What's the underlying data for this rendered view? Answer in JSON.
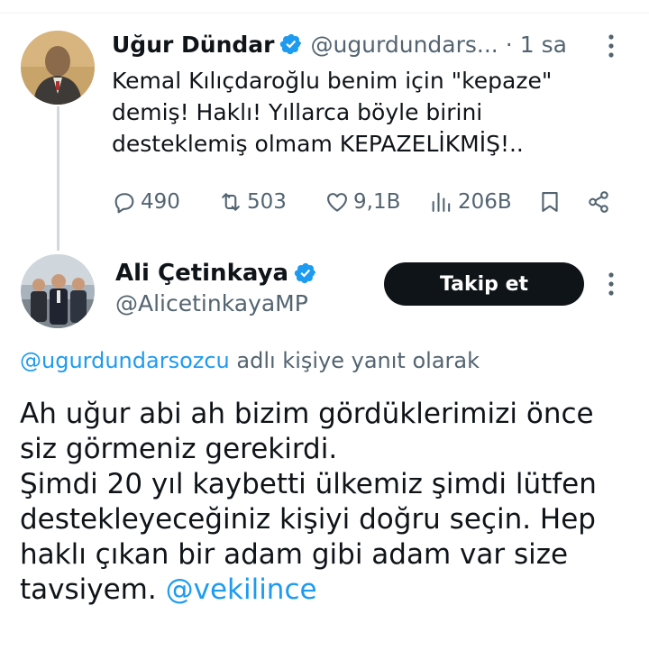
{
  "tweet": {
    "author_name": "Uğur Dündar",
    "author_handle": "@ugurdundars...",
    "separator": "·",
    "time": "1 sa",
    "text_lines": [
      "Kemal Kılıçdaroğlu benim için \"kepaze\"",
      "demiş! Haklı! Yıllarca böyle birini",
      "desteklemiş olmam KEPAZELİKMİŞ!.."
    ],
    "stats": {
      "replies": "490",
      "retweets": "503",
      "likes": "9,1B",
      "views": "206B"
    }
  },
  "reply": {
    "author_name": "Ali Çetinkaya",
    "author_handle": "@AlicetinkayaMP",
    "follow_label": "Takip et",
    "replying_to_mention": "@ugurdundarsozcu",
    "replying_to_text": " adlı kişiye yanıt olarak",
    "text_lines": [
      "Ah uğur abi ah bizim gördüklerimizi önce",
      "siz görmeniz gerekirdi.",
      "Şimdi 20 yıl kaybetti ülkemiz şimdi lütfen",
      "destekleyeceğiniz kişiyi doğru seçin. Hep",
      "haklı çıkan bir adam gibi adam var size"
    ],
    "last_line_text": "tavsiyem. ",
    "last_line_mention": "@vekilince"
  },
  "colors": {
    "text": "#0f1419",
    "secondary": "#536471",
    "link": "#1d9bf0",
    "verified": "#1d9bf0",
    "button_bg": "#0f1419",
    "thread_line": "#cfd9de"
  },
  "icons": {
    "reply": "reply-icon",
    "retweet": "retweet-icon",
    "like": "heart-icon",
    "views": "views-icon",
    "bookmark": "bookmark-icon",
    "share": "share-icon",
    "more": "more-icon",
    "verified": "verified-badge-icon"
  }
}
